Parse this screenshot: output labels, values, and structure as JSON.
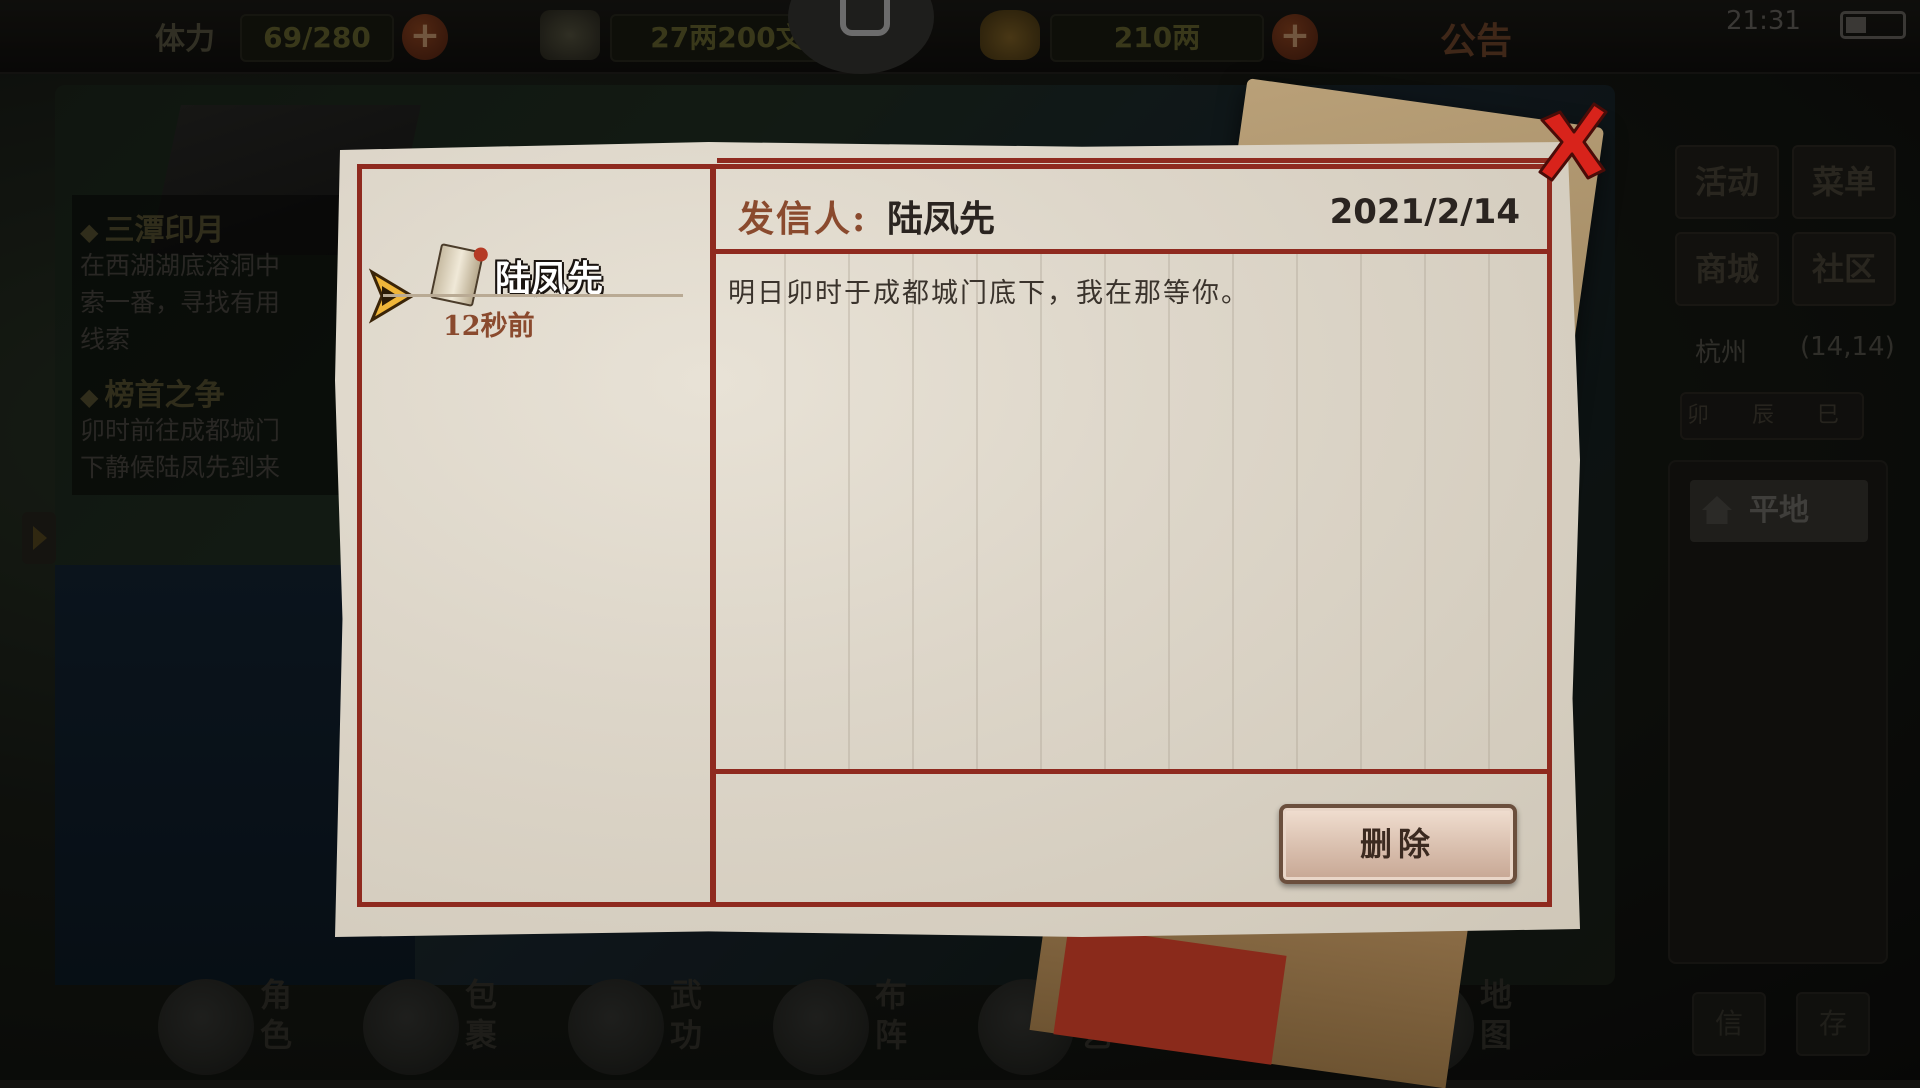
{
  "topbar": {
    "stamina_label": "体力",
    "stamina_value": "69/280",
    "silver_value": "27两200文",
    "gold_value": "210两",
    "notice_label": "公告",
    "clock": "21:31"
  },
  "quests": [
    {
      "title": "三潭印月",
      "desc": "在西湖湖底溶洞中\n索一番，寻找有用\n线索"
    },
    {
      "title": "榜首之争",
      "desc": "卯时前往成都城门\n下静候陆凤先到来"
    }
  ],
  "right_panel": {
    "buttons": [
      "活动",
      "菜单",
      "商城",
      "社区"
    ],
    "location_name": "杭州",
    "location_coords": "(14,14)",
    "time_strip": "卯 辰 巳",
    "terrain": "平地",
    "bottom_buttons": [
      "信",
      "存"
    ]
  },
  "bottom_bar": [
    {
      "label": "角\n色",
      "icon": "character-icon"
    },
    {
      "label": "包\n裹",
      "icon": "bag-icon"
    },
    {
      "label": "武\n功",
      "icon": "martial-arts-icon"
    },
    {
      "label": "布\n阵",
      "icon": "formation-icon"
    },
    {
      "label": "技\n艺",
      "icon": "craft-icon"
    },
    {
      "label": "地\n图",
      "icon": "map-icon"
    }
  ],
  "mail": {
    "list": [
      {
        "sender": "陆凤先",
        "time_ago": "12秒前",
        "icon": "scroll-icon"
      }
    ],
    "from_label": "发信人:",
    "from_name": "陆凤先",
    "date": "2021/2/14",
    "body": "明日卯时于成都城门底下，我在那等你。",
    "delete_label": "删除"
  },
  "colors": {
    "frame_red": "#8f2a1f",
    "paper": "#e3ddd1",
    "close_red": "#d8231b",
    "accent_brown": "#8a4a2e"
  }
}
